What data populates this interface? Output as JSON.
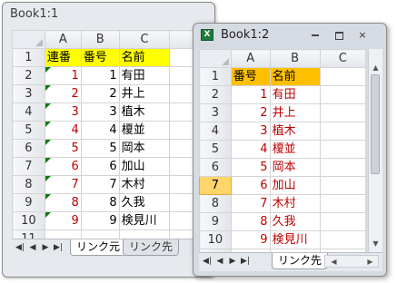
{
  "window1": {
    "title": "Book1:1",
    "columns": [
      "A",
      "B",
      "C"
    ],
    "headers": [
      "連番",
      "番号",
      "名前"
    ],
    "rows": [
      {
        "row": "1"
      },
      {
        "row": "2",
        "a": "1",
        "b": "1",
        "c": "有田"
      },
      {
        "row": "3",
        "a": "2",
        "b": "2",
        "c": "井上"
      },
      {
        "row": "4",
        "a": "3",
        "b": "3",
        "c": "植木"
      },
      {
        "row": "5",
        "a": "4",
        "b": "4",
        "c": "榎並"
      },
      {
        "row": "6",
        "a": "5",
        "b": "5",
        "c": "岡本"
      },
      {
        "row": "7",
        "a": "6",
        "b": "6",
        "c": "加山"
      },
      {
        "row": "8",
        "a": "7",
        "b": "7",
        "c": "木村"
      },
      {
        "row": "9",
        "a": "8",
        "b": "8",
        "c": "久我"
      },
      {
        "row": "10",
        "a": "9",
        "b": "9",
        "c": "検見川"
      },
      {
        "row": "11"
      }
    ],
    "tabs": [
      "リンク元",
      "リンク先"
    ]
  },
  "window2": {
    "title": "Book1:2",
    "icon_letter": "X",
    "columns": [
      "A",
      "B",
      "C"
    ],
    "headers": [
      "番号",
      "名前"
    ],
    "rows": [
      {
        "row": "1"
      },
      {
        "row": "2",
        "a": "1",
        "b": "有田"
      },
      {
        "row": "3",
        "a": "2",
        "b": "井上"
      },
      {
        "row": "4",
        "a": "3",
        "b": "植木"
      },
      {
        "row": "5",
        "a": "4",
        "b": "榎並"
      },
      {
        "row": "6",
        "a": "5",
        "b": "岡本"
      },
      {
        "row": "7",
        "a": "6",
        "b": "加山"
      },
      {
        "row": "8",
        "a": "7",
        "b": "木村"
      },
      {
        "row": "9",
        "a": "8",
        "b": "久我"
      },
      {
        "row": "10",
        "a": "9",
        "b": "検見川"
      },
      {
        "row": "11"
      }
    ],
    "selected_row": "7",
    "tabs": [
      "リンク先"
    ]
  },
  "colors": {
    "header_yellow": "#ffff00",
    "header_orange": "#ffc000",
    "value_red": "#c00000",
    "selected_row_header": "#ffd56a",
    "error_flag_green": "#008000"
  },
  "icons": {
    "close": "×",
    "nav_first": "◀|",
    "nav_prev": "◀",
    "nav_next": "▶",
    "nav_last": "▶|",
    "scroll_up": "▲",
    "scroll_down": "▼"
  }
}
